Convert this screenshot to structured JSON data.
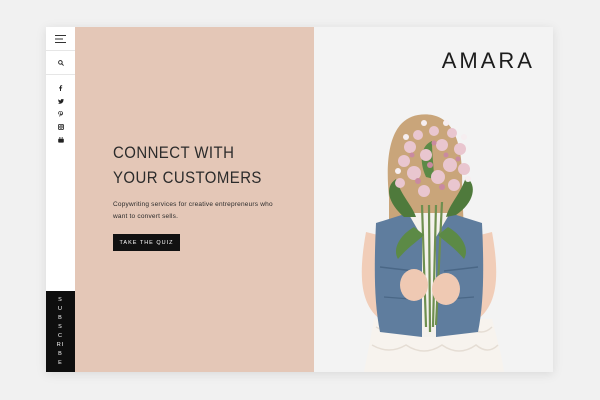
{
  "nav": {
    "icons": [
      "menu-icon",
      "search-icon",
      "facebook-icon",
      "twitter-icon",
      "pinterest-icon",
      "instagram-icon",
      "youtube-icon"
    ],
    "subscribe_label": "SUBSCRIBE"
  },
  "hero": {
    "headline_line1": "CONNECT WITH",
    "headline_line2": "YOUR CUSTOMERS",
    "subtext": "Copywriting services for creative entrepreneurs who want to convert sells.",
    "cta_label": "TAKE THE QUIZ"
  },
  "brand": {
    "logo": "AMARA"
  },
  "colors": {
    "blush": "#e4c7b7",
    "black": "#111111",
    "background": "#f1f1f1"
  }
}
